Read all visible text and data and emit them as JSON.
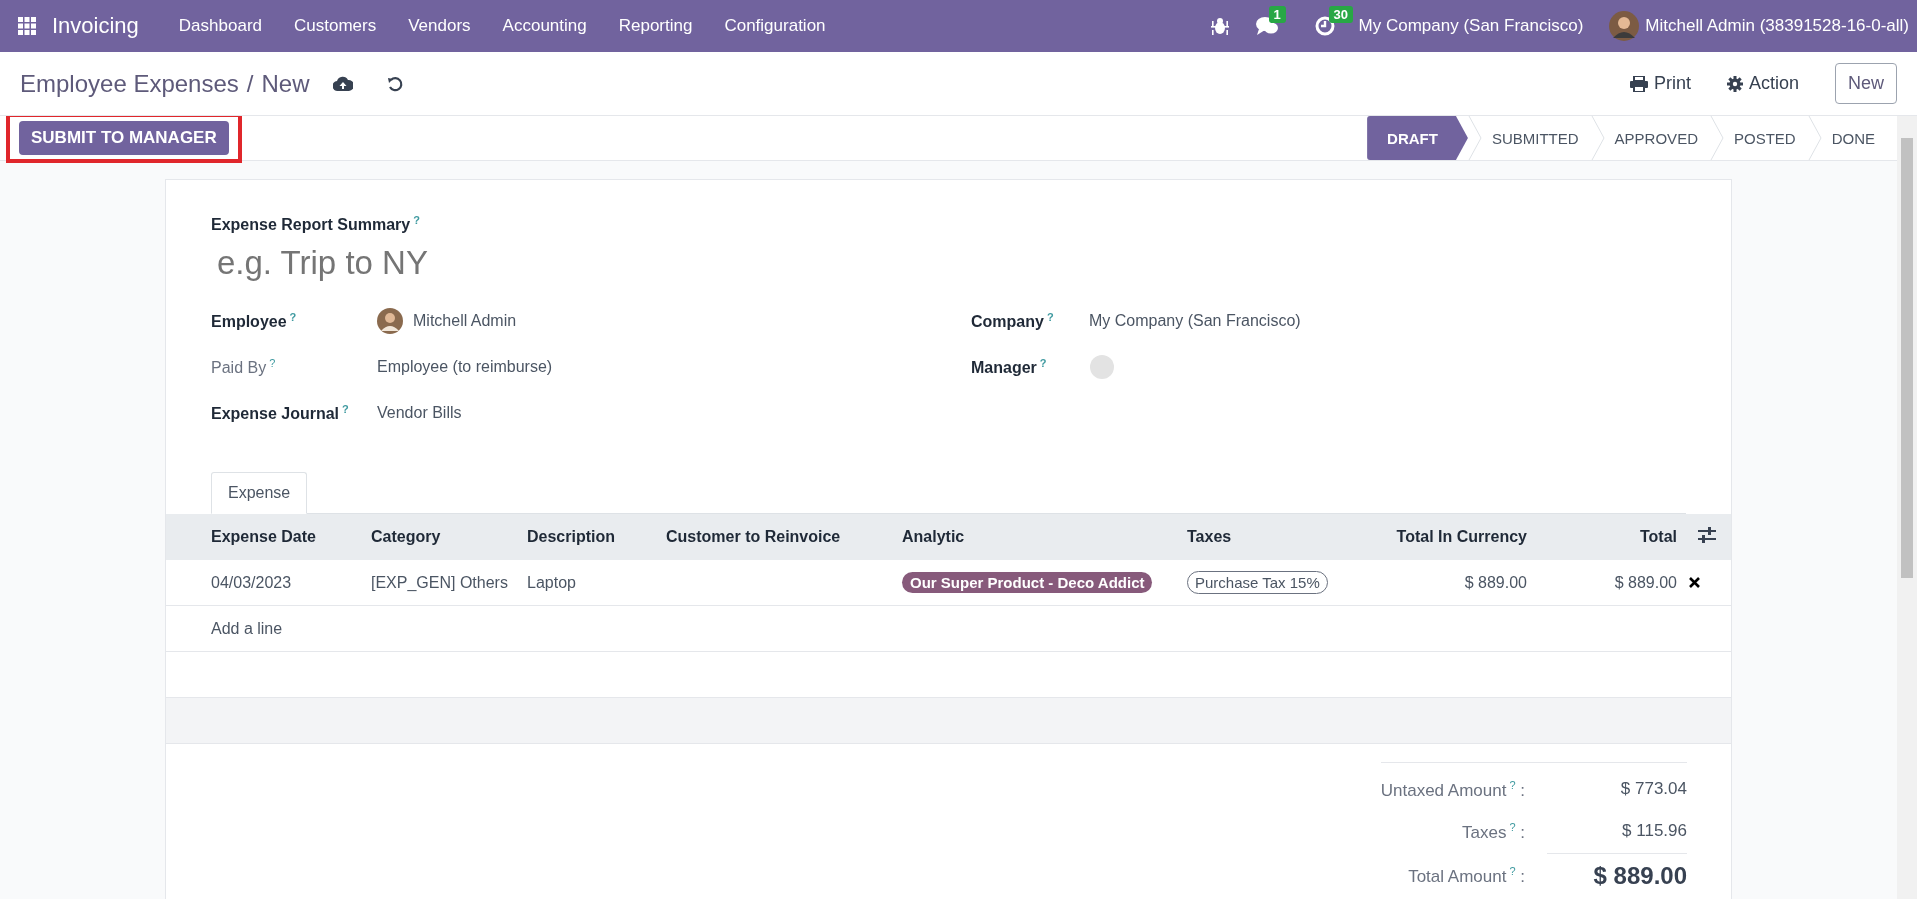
{
  "navbar": {
    "app_name": "Invoicing",
    "menu": [
      "Dashboard",
      "Customers",
      "Vendors",
      "Accounting",
      "Reporting",
      "Configuration"
    ],
    "messages_badge": "1",
    "activities_badge": "30",
    "company": "My Company (San Francisco)",
    "user": "Mitchell Admin (38391528-16-0-all)"
  },
  "breadcrumb": {
    "parent": "Employee Expenses",
    "separator": "/",
    "current": "New"
  },
  "actions": {
    "print": "Print",
    "action": "Action",
    "new": "New"
  },
  "submit_button": {
    "label": "SUBMIT TO MANAGER",
    "highlighted": true
  },
  "statusbar": [
    {
      "label": "DRAFT",
      "selected": true
    },
    {
      "label": "SUBMITTED",
      "selected": false
    },
    {
      "label": "APPROVED",
      "selected": false
    },
    {
      "label": "POSTED",
      "selected": false
    },
    {
      "label": "DONE",
      "selected": false
    }
  ],
  "form": {
    "summary_label": "Expense Report Summary$^{?}$",
    "summary_placeholder": "e.g. Trip to NY",
    "fields_left": [
      {
        "label": "Employee$^{?}$",
        "muted": false,
        "kind": "person",
        "value": "Mitchell Admin"
      },
      {
        "label": "Paid By$^{?}$",
        "muted": true,
        "kind": "text",
        "value": "Employee (to reimburse)"
      },
      {
        "label": "Expense Journal$^{?}$",
        "muted": false,
        "kind": "text",
        "value": "Vendor Bills"
      }
    ],
    "fields_right": [
      {
        "label": "Company$^{?}$",
        "muted": false,
        "kind": "text",
        "value": "My Company (San Francisco)"
      },
      {
        "label": "Manager$^{?}$",
        "muted": false,
        "kind": "empty-person"
      }
    ],
    "tabs": [
      {
        "label": "Expense",
        "selected": true
      }
    ],
    "table": {
      "columns": [
        {
          "label": "Expense Date",
          "kind": "text"
        },
        {
          "label": "Category",
          "kind": "text"
        },
        {
          "label": "Description",
          "kind": "text"
        },
        {
          "label": "Customer to Reinvoice",
          "kind": "text"
        },
        {
          "label": "Analytic",
          "kind": "text"
        },
        {
          "label": "Taxes",
          "kind": "text"
        },
        {
          "label": "Total In Currency",
          "kind": "amount"
        },
        {
          "label": "Total",
          "kind": "amount"
        }
      ],
      "rows": [
        {
          "cells": [
            {
              "kind": "text",
              "text": "04/03/2023"
            },
            {
              "kind": "text",
              "text": "[EXP_GEN] Others"
            },
            {
              "kind": "text",
              "text": "Laptop"
            },
            {
              "kind": "empty"
            },
            {
              "kind": "tag",
              "text": "Our Super Product - Deco Addict",
              "color": "#875a7b"
            },
            {
              "kind": "outline-tag",
              "text": "Purchase Tax 15%"
            },
            {
              "kind": "text",
              "text": "$ 889.00"
            },
            {
              "kind": "text",
              "text": "$ 889.00"
            }
          ]
        }
      ],
      "add_line": "Add a line"
    },
    "totals": [
      {
        "label": "Untaxed Amount$^{?}$ :",
        "value": "$ 773.04",
        "kind": "line"
      },
      {
        "label": "Taxes$^{?}$ :",
        "value": "$ 115.96",
        "kind": "line"
      },
      {
        "label": "Total Amount$^{?}$ :",
        "value": "$ 889.00",
        "kind": "grand"
      }
    ]
  }
}
